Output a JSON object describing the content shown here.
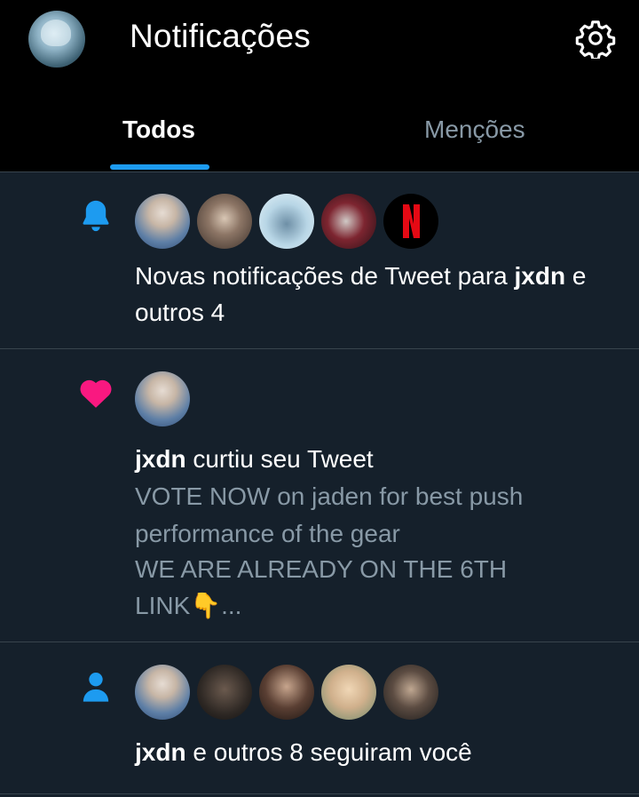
{
  "header": {
    "title": "Notificações",
    "settings_icon": "gear-icon"
  },
  "tabs": [
    {
      "label": "Todos",
      "active": true
    },
    {
      "label": "Menções",
      "active": false
    }
  ],
  "colors": {
    "background": "#15202b",
    "header_background": "#000000",
    "accent": "#1d9bf0",
    "like": "#f91880",
    "muted_text": "#8899a6"
  },
  "notifications": [
    {
      "type": "tweet-notification",
      "icon": "bell-icon",
      "text_before": "Novas notificações de Tweet para ",
      "bold": "jxdn",
      "text_after": " e outros 4"
    },
    {
      "type": "like",
      "icon": "heart-icon",
      "bold": "jxdn",
      "text_after": " curtiu seu Tweet",
      "preview_lines": [
        "VOTE NOW on jaden for best push",
        "performance of the gear",
        "WE ARE ALREADY ON THE 6TH",
        "LINK👇..."
      ]
    },
    {
      "type": "follow",
      "icon": "person-icon",
      "bold": "jxdn",
      "text_after": " e outros 8 seguiram você"
    }
  ]
}
